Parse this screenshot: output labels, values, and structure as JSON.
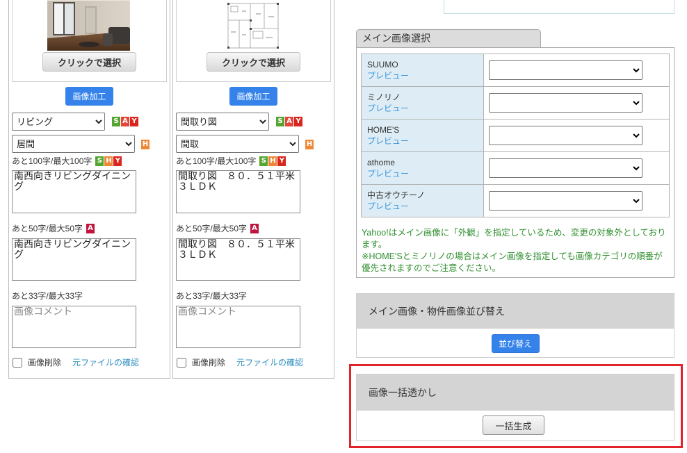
{
  "image_cards": [
    {
      "pick_button": "クリックで選択",
      "edit_button": "画像加工",
      "category": "リビング",
      "category_badges": [
        "S",
        "A",
        "Y"
      ],
      "subcategory": "居間",
      "subcategory_badges": [
        "H"
      ],
      "caption_long": {
        "counter": "あと100字/最大100字",
        "badges": [
          "S",
          "H",
          "Y"
        ],
        "value": "南西向きリビングダイニング"
      },
      "caption_short": {
        "counter": "あと50字/最大50字",
        "badges": [
          "A"
        ],
        "value": "南西向きリビングダイニング"
      },
      "comment": {
        "counter": "あと33字/最大33字",
        "placeholder": "画像コメント"
      },
      "delete_label": "画像削除",
      "delete_checked": false,
      "original_file_link": "元ファイルの確認"
    },
    {
      "pick_button": "クリックで選択",
      "edit_button": "画像加工",
      "category": "間取り図",
      "category_badges": [
        "S",
        "A",
        "Y"
      ],
      "subcategory": "間取",
      "subcategory_badges": [
        "H"
      ],
      "caption_long": {
        "counter": "あと100字/最大100字",
        "badges": [
          "S",
          "H",
          "Y"
        ],
        "value": "間取り図　８０．５１平米　３ＬＤＫ"
      },
      "caption_short": {
        "counter": "あと50字/最大50字",
        "badges": [
          "A"
        ],
        "value": "間取り図　８０．５１平米　３ＬＤＫ"
      },
      "comment": {
        "counter": "あと33字/最大33字",
        "placeholder": "画像コメント"
      },
      "delete_label": "画像削除",
      "delete_checked": false,
      "original_file_link": "元ファイルの確認"
    }
  ],
  "main_image_panel": {
    "tab_label": "メイン画像選択",
    "rows": [
      {
        "portal": "SUUMO",
        "preview_link": "プレビュー"
      },
      {
        "portal": "ミノリノ",
        "preview_link": "プレビュー"
      },
      {
        "portal": "HOME'S",
        "preview_link": "プレビュー"
      },
      {
        "portal": "athome",
        "preview_link": "プレビュー"
      },
      {
        "portal": "中古オウチーノ",
        "preview_link": "プレビュー"
      }
    ],
    "notes": [
      "Yahoo!はメイン画像に「外観」を指定しているため、変更の対象外としております。",
      "※HOME'Sとミノリノの場合はメイン画像を指定しても画像カテゴリの順番が優先されますのでご注意ください。"
    ]
  },
  "sort_panel": {
    "title": "メイン画像・物件画像並び替え",
    "button_label": "並び替え"
  },
  "watermark_panel": {
    "title": "画像一括透かし",
    "button_label": "一括生成"
  },
  "colors": {
    "primary": "#3583ea",
    "badge_s": "#55a530",
    "badge_a": "#e5433c",
    "badge_y": "#d9261f",
    "badge_h": "#ec8838",
    "badge_a_short": "#c3143e",
    "link": "#2c8fc2",
    "preview": "#3a95dc",
    "note": "#2f8f2f",
    "highlight": "#e1242c",
    "label_bg": "#deedf5"
  }
}
